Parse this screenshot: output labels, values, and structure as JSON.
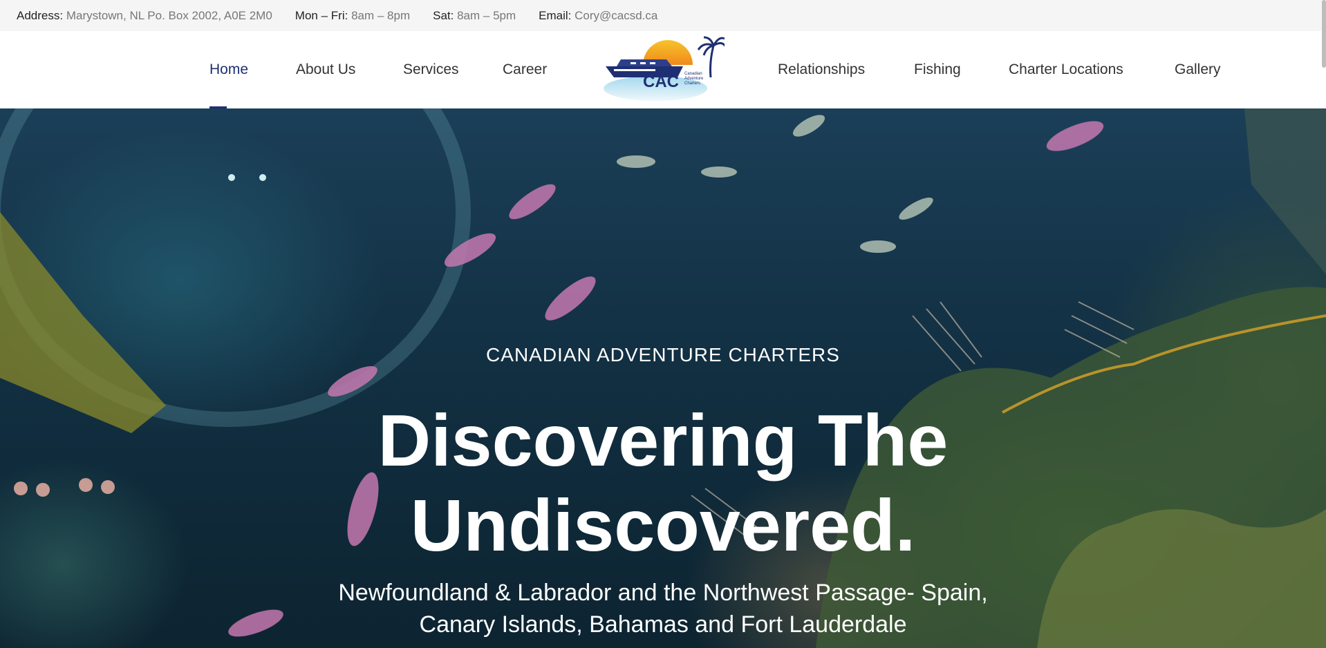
{
  "topbar": {
    "address": {
      "label": "Address:",
      "value": "Marystown, NL Po. Box 2002, A0E 2M0"
    },
    "weekday": {
      "label": "Mon – Fri:",
      "value": "8am – 8pm"
    },
    "saturday": {
      "label": "Sat:",
      "value": "8am – 5pm"
    },
    "email": {
      "label": "Email:",
      "value": "Cory@cacsd.ca"
    }
  },
  "nav": {
    "left": [
      "Home",
      "About Us",
      "Services",
      "Career"
    ],
    "right": [
      "Relationships",
      "Fishing",
      "Charter Locations",
      "Gallery"
    ],
    "active": "Home"
  },
  "logo": {
    "text": "CAC",
    "tagline": [
      "Canadian",
      "Adventure",
      "Charters"
    ],
    "icons": [
      "boat-icon",
      "sun-icon",
      "palm-tree-icon"
    ]
  },
  "hero": {
    "eyebrow": "CANADIAN ADVENTURE CHARTERS",
    "title_line1": "Discovering The",
    "title_line2": "Undiscovered.",
    "subtitle_line1": "Newfoundland & Labrador and the Northwest Passage- Spain,",
    "subtitle_line2": "Canary Islands, Bahamas and Fort Lauderdale"
  },
  "colors": {
    "accent": "#1f2f73",
    "topbar_bg": "#f5f5f5",
    "hero_text": "#ffffff"
  }
}
